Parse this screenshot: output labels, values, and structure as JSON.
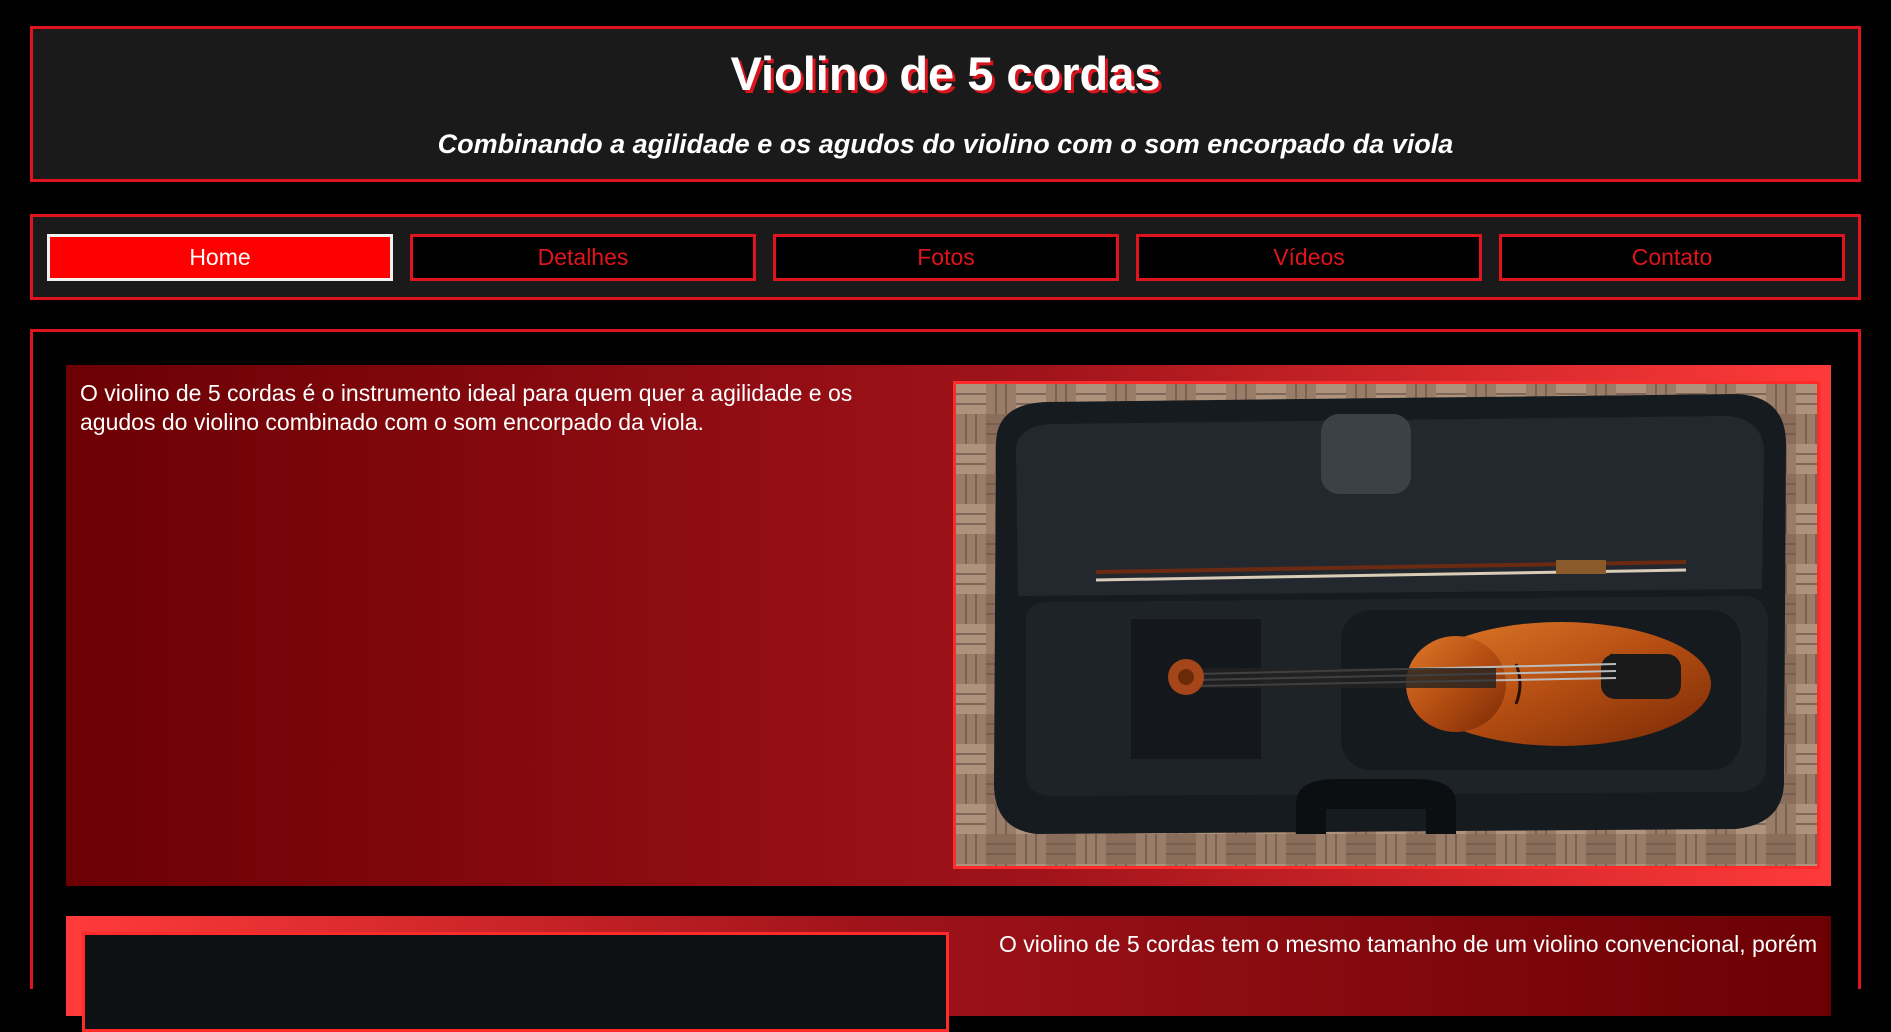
{
  "header": {
    "title": "Violino de 5 cordas",
    "subtitle": "Combinando a agilidade e os agudos do violino com o som encorpado da viola"
  },
  "nav": {
    "items": [
      {
        "label": "Home",
        "active": true
      },
      {
        "label": "Detalhes",
        "active": false
      },
      {
        "label": "Fotos",
        "active": false
      },
      {
        "label": "Vídeos",
        "active": false
      },
      {
        "label": "Contato",
        "active": false
      }
    ]
  },
  "sections": [
    {
      "text": "O violino de 5 cordas é o instrumento ideal para quem quer a agilidade e os agudos do violino combinado com o som encorpado da viola."
    },
    {
      "text": "O violino de 5 cordas tem o mesmo tamanho de um violino convencional, porém"
    }
  ],
  "colors": {
    "accent": "#e0141c",
    "active_nav": "#ff0000",
    "panel": "#1a1a1a"
  }
}
